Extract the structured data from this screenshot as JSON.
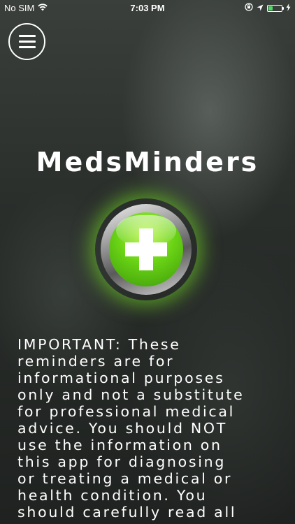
{
  "status_bar": {
    "carrier": "No SIM",
    "time": "7:03 PM",
    "wifi_icon": "wifi-icon",
    "rotation_lock_icon": "rotation-lock-icon",
    "location_icon": "location-arrow-icon",
    "battery_icon": "battery-icon",
    "charging_icon": "charging-bolt-icon",
    "battery_level": 0.35,
    "battery_color": "#4cd964"
  },
  "header": {
    "menu_icon": "hamburger-menu-icon"
  },
  "main": {
    "app_title": "MedsMinders",
    "add_button_icon": "plus-icon",
    "add_button_color": "#6ad315",
    "disclaimer": "IMPORTANT: These\nreminders are for\ninformational purposes\nonly and not a substitute\nfor professional medical\nadvice. You should NOT\nuse the information on\nthis app for diagnosing\nor treating a medical or\nhealth condition. You\nshould carefully read all"
  }
}
